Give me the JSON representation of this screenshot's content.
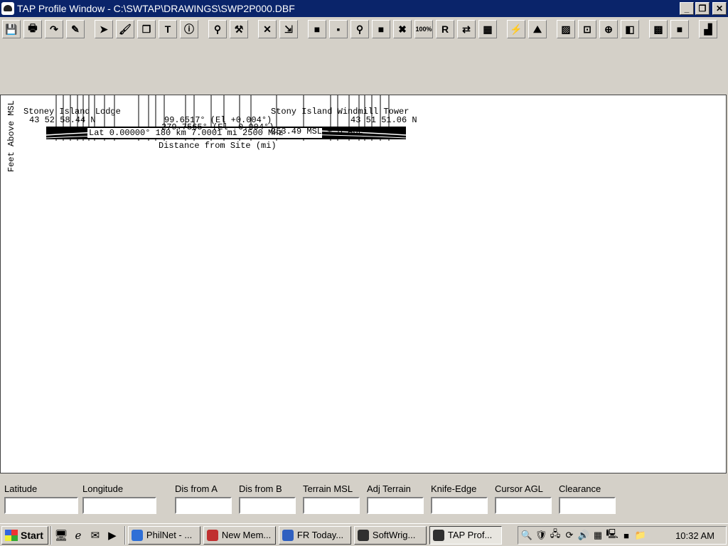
{
  "window": {
    "title": "TAP Profile Window - C:\\SWTAP\\DRAWINGS\\SWP2P000.DBF",
    "minimize_glyph": "_",
    "restore_glyph": "❐",
    "close_glyph": "✕"
  },
  "toolbar": {
    "buttons": [
      {
        "name": "save-icon",
        "glyph": "💾"
      },
      {
        "name": "print-icon",
        "glyph": "🖶"
      },
      {
        "name": "redo-arrow-icon",
        "glyph": "↷"
      },
      {
        "name": "edit-check-icon",
        "glyph": "✎"
      },
      {
        "name": "pointer-icon",
        "glyph": "➤"
      },
      {
        "name": "paint-icon",
        "glyph": "🖌"
      },
      {
        "name": "copy-icon",
        "glyph": "❐"
      },
      {
        "name": "text-tool-icon",
        "glyph": "T"
      },
      {
        "name": "info-icon",
        "glyph": "ⓘ"
      },
      {
        "name": "link-icon",
        "glyph": "⚲"
      },
      {
        "name": "wrench-icon",
        "glyph": "⚒"
      },
      {
        "name": "delete-icon",
        "glyph": "✕"
      },
      {
        "name": "exit-icon",
        "glyph": "⇲"
      },
      {
        "name": "green-box-icon",
        "glyph": "■"
      },
      {
        "name": "green-dot-icon",
        "glyph": "▪"
      },
      {
        "name": "pin-icon",
        "glyph": "⚲"
      },
      {
        "name": "red-box-icon",
        "glyph": "■"
      },
      {
        "name": "red-x-icon",
        "glyph": "✖"
      },
      {
        "name": "zoom-100-icon",
        "glyph": "100%"
      },
      {
        "name": "yellow-r-icon",
        "glyph": "R"
      },
      {
        "name": "swap-icon",
        "glyph": "⇄"
      },
      {
        "name": "grid-icon",
        "glyph": "▦"
      },
      {
        "name": "antenna-icon",
        "glyph": "⚡"
      },
      {
        "name": "terrain-icon",
        "glyph": "⛰"
      },
      {
        "name": "hatch-icon",
        "glyph": "▨"
      },
      {
        "name": "zoom-box-icon",
        "glyph": "⊡"
      },
      {
        "name": "crosshair-icon",
        "glyph": "⊕"
      },
      {
        "name": "color-layers-icon",
        "glyph": "◧"
      },
      {
        "name": "select-region-icon",
        "glyph": "▩"
      },
      {
        "name": "gray-square-icon",
        "glyph": "■"
      },
      {
        "name": "bar-chart-icon",
        "glyph": "▟"
      }
    ]
  },
  "profile": {
    "site_a_name": "Stoney Island Lodge",
    "site_b_name": "Stony Island Windmill Tower",
    "site_a_lat": "43 52 58.44 N",
    "site_b_lat": "43 51 51.06 N",
    "azimuth_ab": "99.6517° (El +0.004°)",
    "azimuth_ba": "279.7565° (El -0.004°)",
    "site_b_msl": "253.49 MSL + 0 AGL",
    "distance_label": "Lat 0.00000° 180 km 7.0001 mi  2500 MHz",
    "x_axis_label": "Distance from Site (mi)",
    "y_axis_label": "Feet Above MSL"
  },
  "fields": [
    {
      "label": "Latitude",
      "value": ""
    },
    {
      "label": "Longitude",
      "value": ""
    },
    {
      "label": "Dis from A",
      "value": ""
    },
    {
      "label": "Dis from B",
      "value": ""
    },
    {
      "label": "Terrain MSL",
      "value": ""
    },
    {
      "label": "Adj Terrain",
      "value": ""
    },
    {
      "label": "Knife-Edge",
      "value": ""
    },
    {
      "label": "Cursor AGL",
      "value": ""
    },
    {
      "label": "Clearance",
      "value": ""
    }
  ],
  "taskbar": {
    "start_label": "Start",
    "tasks": [
      {
        "label": "PhilNet - ...",
        "color": "#2f6fd6"
      },
      {
        "label": "New Mem...",
        "color": "#c03030"
      },
      {
        "label": "FR Today...",
        "color": "#3060c0"
      },
      {
        "label": "SoftWrig...",
        "color": "#303030"
      },
      {
        "label": "TAP Prof...",
        "color": "#303030",
        "active": true
      }
    ],
    "clock": "10:32 AM"
  }
}
